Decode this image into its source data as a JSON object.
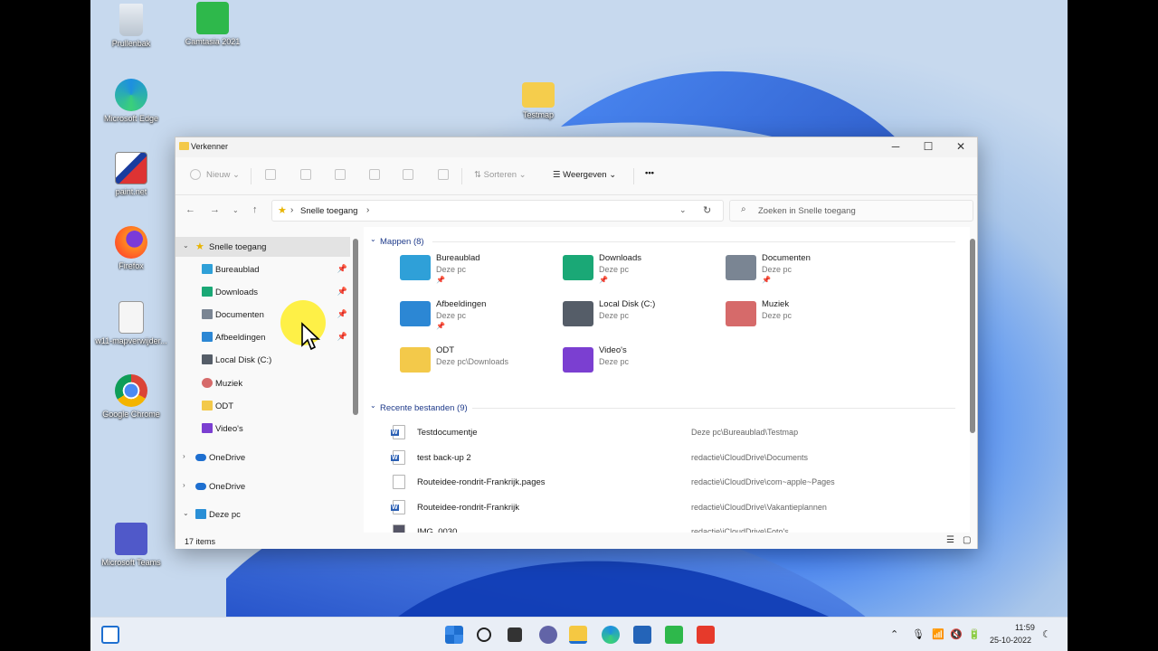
{
  "desktop": {
    "icons": [
      {
        "label": "Prullenbak",
        "icon": "recycle-bin-icon"
      },
      {
        "label": "Camtasia 2021",
        "icon": "camtasia-icon"
      },
      {
        "label": "Microsoft Edge",
        "icon": "edge-icon"
      },
      {
        "label": "Testmap",
        "icon": "folder-icon"
      },
      {
        "label": "paint.net",
        "icon": "paintnet-icon"
      },
      {
        "label": "Firefox",
        "icon": "firefox-icon"
      },
      {
        "label": "w11-mapverwijder...",
        "icon": "video-file-icon"
      },
      {
        "label": "Google Chrome",
        "icon": "chrome-icon"
      },
      {
        "label": "Microsoft Teams",
        "icon": "teams-icon"
      }
    ]
  },
  "window": {
    "title": "Verkenner",
    "controls": {
      "minimize": "─",
      "maximize": "☐",
      "close": "✕"
    }
  },
  "toolbar": {
    "new_label": "Nieuw",
    "sort_label": "Sorteren",
    "view_label": "Weergeven",
    "more_label": "•••"
  },
  "address": {
    "path": "Snelle toegang",
    "sep": "›",
    "search_placeholder": "Zoeken in Snelle toegang"
  },
  "nav": {
    "quick_access": "Snelle toegang",
    "items": [
      {
        "label": "Bureaublad",
        "color": "#2fa0d8"
      },
      {
        "label": "Downloads",
        "color": "#1aa876"
      },
      {
        "label": "Documenten",
        "color": "#7a8593"
      },
      {
        "label": "Afbeeldingen",
        "color": "#2c87d4"
      },
      {
        "label": "Local Disk (C:)",
        "color": "#555d68"
      },
      {
        "label": "Muziek",
        "color": "#d66a6a"
      },
      {
        "label": "ODT",
        "color": "#f3c94a"
      },
      {
        "label": "Video's",
        "color": "#7b3fd1"
      }
    ],
    "onedrive1": "OneDrive",
    "onedrive2": "OneDrive",
    "this_pc": "Deze pc"
  },
  "content": {
    "folders_header": "Mappen (8)",
    "folders": [
      {
        "name": "Bureaublad",
        "sub": "Deze pc",
        "pinned": true,
        "color": "#2fa0d8"
      },
      {
        "name": "Downloads",
        "sub": "Deze pc",
        "pinned": true,
        "color": "#1aa876"
      },
      {
        "name": "Documenten",
        "sub": "Deze pc",
        "pinned": true,
        "color": "#7a8593"
      },
      {
        "name": "Afbeeldingen",
        "sub": "Deze pc",
        "pinned": true,
        "color": "#2c87d4"
      },
      {
        "name": "Local Disk (C:)",
        "sub": "Deze pc",
        "pinned": false,
        "color": "#555d68"
      },
      {
        "name": "Muziek",
        "sub": "Deze pc",
        "pinned": false,
        "color": "#d66a6a"
      },
      {
        "name": "ODT",
        "sub": "Deze pc\\Downloads",
        "pinned": false,
        "color": "#f3c94a"
      },
      {
        "name": "Video's",
        "sub": "Deze pc",
        "pinned": false,
        "color": "#7b3fd1"
      }
    ],
    "recent_header": "Recente bestanden (9)",
    "recent": [
      {
        "name": "Testdocumentje",
        "path": "Deze pc\\Bureaublad\\Testmap",
        "type": "word"
      },
      {
        "name": "test back-up 2",
        "path": "redactie\\iCloudDrive\\Documents",
        "type": "word"
      },
      {
        "name": "Routeidee-rondrit-Frankrijk.pages",
        "path": "redactie\\iCloudDrive\\com~apple~Pages",
        "type": "blank"
      },
      {
        "name": "Routeidee-rondrit-Frankrijk",
        "path": "redactie\\iCloudDrive\\Vakantieplannen",
        "type": "word"
      },
      {
        "name": "IMG_0030",
        "path": "redactie\\iCloudDrive\\Foto's",
        "type": "image"
      }
    ]
  },
  "status": {
    "count": "17 items"
  },
  "taskbar": {
    "time": "11:59",
    "date": "25-10-2022"
  }
}
